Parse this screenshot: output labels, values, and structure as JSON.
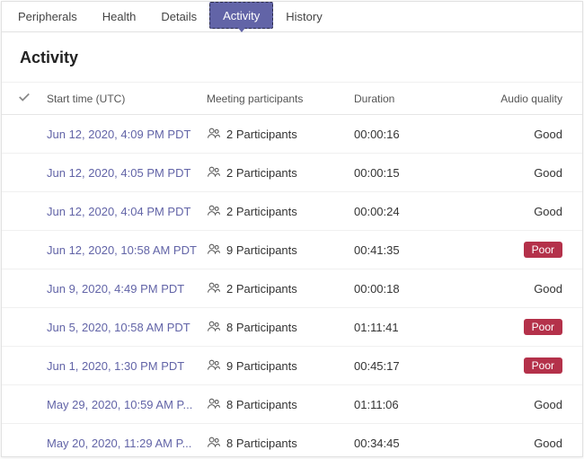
{
  "tabs": [
    {
      "label": "Peripherals",
      "active": false
    },
    {
      "label": "Health",
      "active": false
    },
    {
      "label": "Details",
      "active": false
    },
    {
      "label": "Activity",
      "active": true
    },
    {
      "label": "History",
      "active": false
    }
  ],
  "page_title": "Activity",
  "columns": {
    "checkbox": "",
    "start": "Start time (UTC)",
    "participants": "Meeting participants",
    "duration": "Duration",
    "quality": "Audio quality"
  },
  "quality_labels": {
    "good": "Good",
    "poor": "Poor"
  },
  "rows": [
    {
      "start": "Jun 12, 2020, 4:09 PM PDT",
      "participants": "2 Participants",
      "duration": "00:00:16",
      "quality": "good"
    },
    {
      "start": "Jun 12, 2020, 4:05 PM PDT",
      "participants": "2 Participants",
      "duration": "00:00:15",
      "quality": "good"
    },
    {
      "start": "Jun 12, 2020, 4:04 PM PDT",
      "participants": "2 Participants",
      "duration": "00:00:24",
      "quality": "good"
    },
    {
      "start": "Jun 12, 2020, 10:58 AM PDT",
      "participants": "9 Participants",
      "duration": "00:41:35",
      "quality": "poor"
    },
    {
      "start": "Jun 9, 2020, 4:49 PM PDT",
      "participants": "2 Participants",
      "duration": "00:00:18",
      "quality": "good"
    },
    {
      "start": "Jun 5, 2020, 10:58 AM PDT",
      "participants": "8 Participants",
      "duration": "01:11:41",
      "quality": "poor"
    },
    {
      "start": "Jun 1, 2020, 1:30 PM PDT",
      "participants": "9 Participants",
      "duration": "00:45:17",
      "quality": "poor"
    },
    {
      "start": "May 29, 2020, 10:59 AM P...",
      "participants": "8 Participants",
      "duration": "01:11:06",
      "quality": "good"
    },
    {
      "start": "May 20, 2020, 11:29 AM P...",
      "participants": "8 Participants",
      "duration": "00:34:45",
      "quality": "good"
    }
  ]
}
